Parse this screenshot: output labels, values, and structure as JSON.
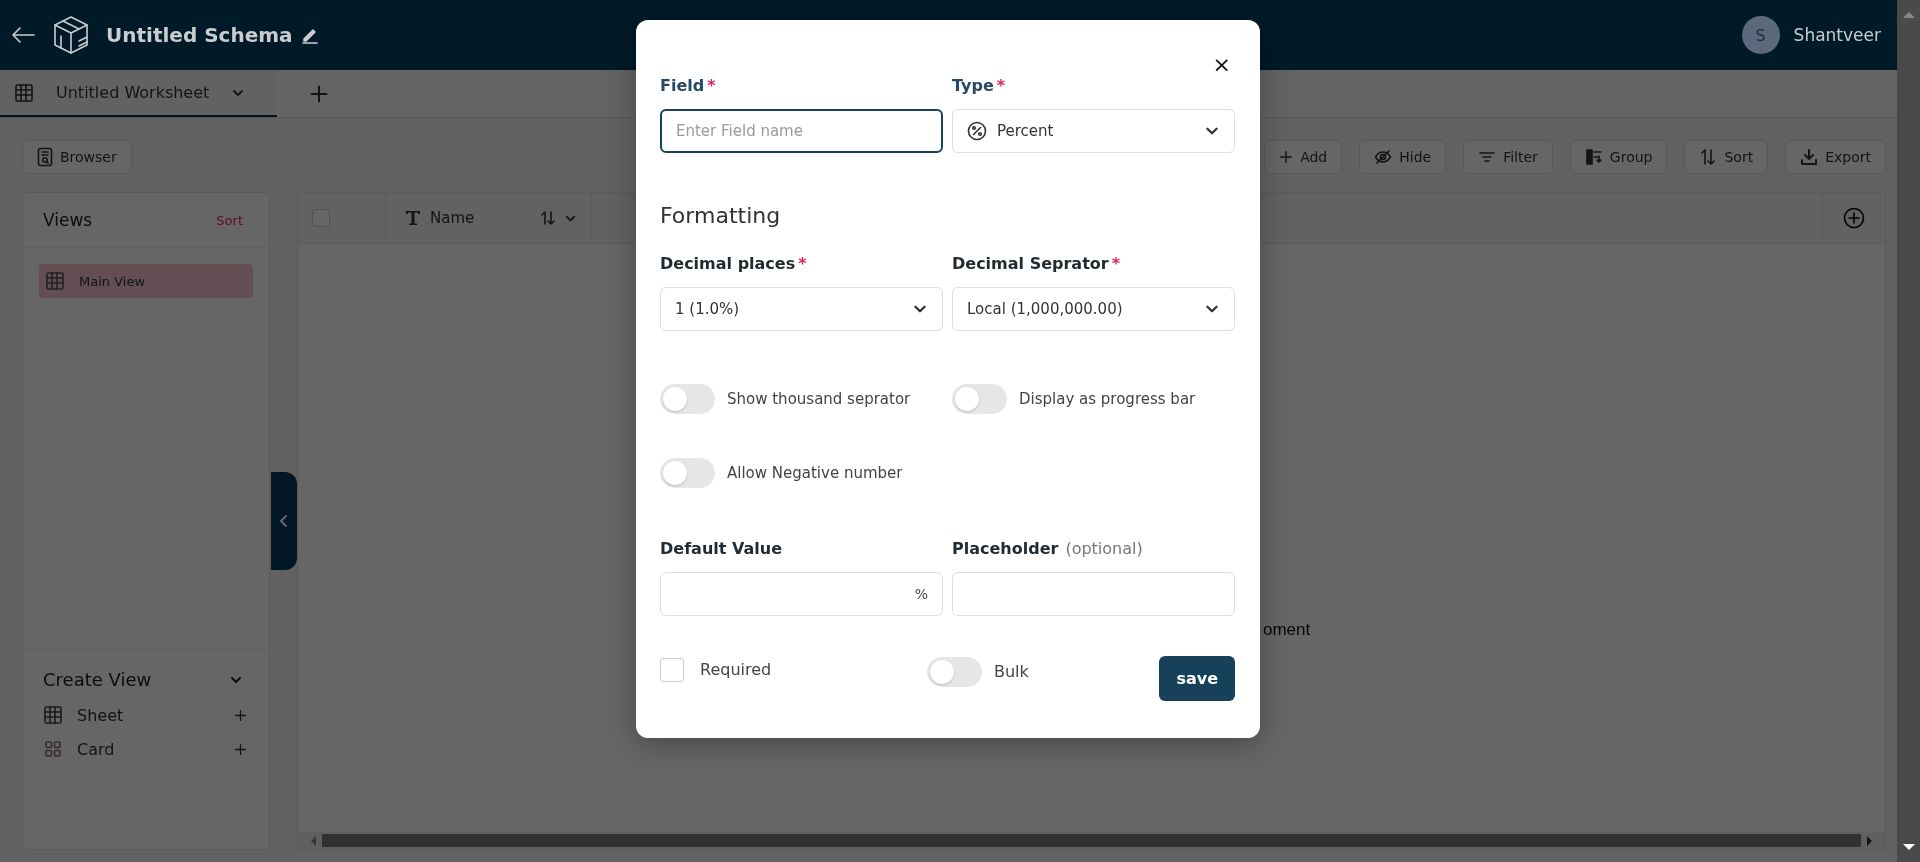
{
  "header": {
    "title": "Untitled Schema",
    "user": {
      "initial": "S",
      "name": "Shantveer"
    }
  },
  "worksheet_tabs": [
    {
      "label": "Untitled Worksheet",
      "selected": true
    }
  ],
  "toolbar": {
    "browser": "Browser",
    "actions": [
      {
        "kind": "add",
        "label": "Add"
      },
      {
        "kind": "hide",
        "label": "Hide"
      },
      {
        "kind": "filter",
        "label": "Filter"
      },
      {
        "kind": "group",
        "label": "Group"
      },
      {
        "kind": "sort",
        "label": "Sort"
      },
      {
        "kind": "export",
        "label": "Export"
      }
    ]
  },
  "views_panel": {
    "title": "Views",
    "sort": "Sort",
    "views": [
      {
        "label": "Main View",
        "selected": true
      }
    ],
    "create": {
      "title": "Create View",
      "expanded": true,
      "items": [
        {
          "kind": "sheet",
          "label": "Sheet"
        },
        {
          "kind": "card",
          "label": "Card"
        }
      ]
    }
  },
  "grid": {
    "select_all": {
      "checked": false
    },
    "columns": [
      {
        "kind": "text",
        "label": "Name"
      }
    ],
    "message": "oment"
  },
  "dialog": {
    "close": "×",
    "field": {
      "label": "Field",
      "mark": "*",
      "placeholder": "Enter Field name"
    },
    "type": {
      "label": "Type",
      "mark": "*",
      "value": "Percent"
    },
    "section": "Formatting",
    "decimal_places": {
      "label": "Decimal places",
      "mark": "*",
      "value": "1 (1.0%)"
    },
    "decimal_separator": {
      "label": "Decimal Seprator",
      "mark": "*",
      "value": "Local (1,000,000.00)"
    },
    "toggles": [
      {
        "label": "Show thousand seprator",
        "on": false
      },
      {
        "label": "Display as progress bar",
        "on": false
      },
      {
        "label": "Allow Negative number",
        "on": false
      }
    ],
    "default_value": {
      "label": "Default Value",
      "suffix": "%"
    },
    "placeholder_field": {
      "label": "Placeholder",
      "note": "(optional)"
    },
    "required": {
      "label": "Required",
      "checked": false
    },
    "bulk": {
      "label": "Bulk",
      "on": false
    },
    "save": "save"
  }
}
